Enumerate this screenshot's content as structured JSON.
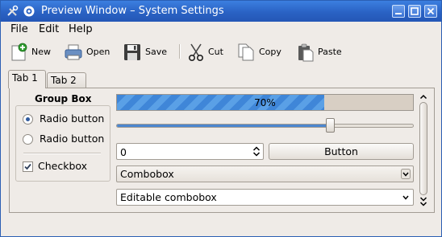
{
  "window": {
    "title": "Preview Window – System Settings",
    "colors": {
      "titlebar": "#2a62c4",
      "accent": "#3f86d8",
      "background": "#efebe7"
    },
    "icons": [
      "tools-icon",
      "kde-gear-icon"
    ],
    "buttons": [
      "minimize",
      "maximize",
      "close"
    ]
  },
  "menu": {
    "items": [
      "File",
      "Edit",
      "Help"
    ]
  },
  "toolbar": {
    "new_label": "New",
    "open_label": "Open",
    "save_label": "Save",
    "cut_label": "Cut",
    "copy_label": "Copy",
    "paste_label": "Paste"
  },
  "tabs": [
    {
      "label": "Tab 1",
      "active": true
    },
    {
      "label": "Tab 2",
      "active": false
    }
  ],
  "group": {
    "title": "Group Box",
    "radio1": {
      "label": "Radio button",
      "checked": true
    },
    "radio2": {
      "label": "Radio button",
      "checked": false
    },
    "checkbox": {
      "label": "Checkbox",
      "checked": true
    }
  },
  "progress": {
    "value": 70,
    "text": "70%"
  },
  "slider": {
    "value": 0.72
  },
  "spinbox": {
    "value": "0"
  },
  "button": {
    "label": "Button"
  },
  "combobox": {
    "value": "Combobox"
  },
  "editable_combobox": {
    "value": "Editable combobox"
  }
}
